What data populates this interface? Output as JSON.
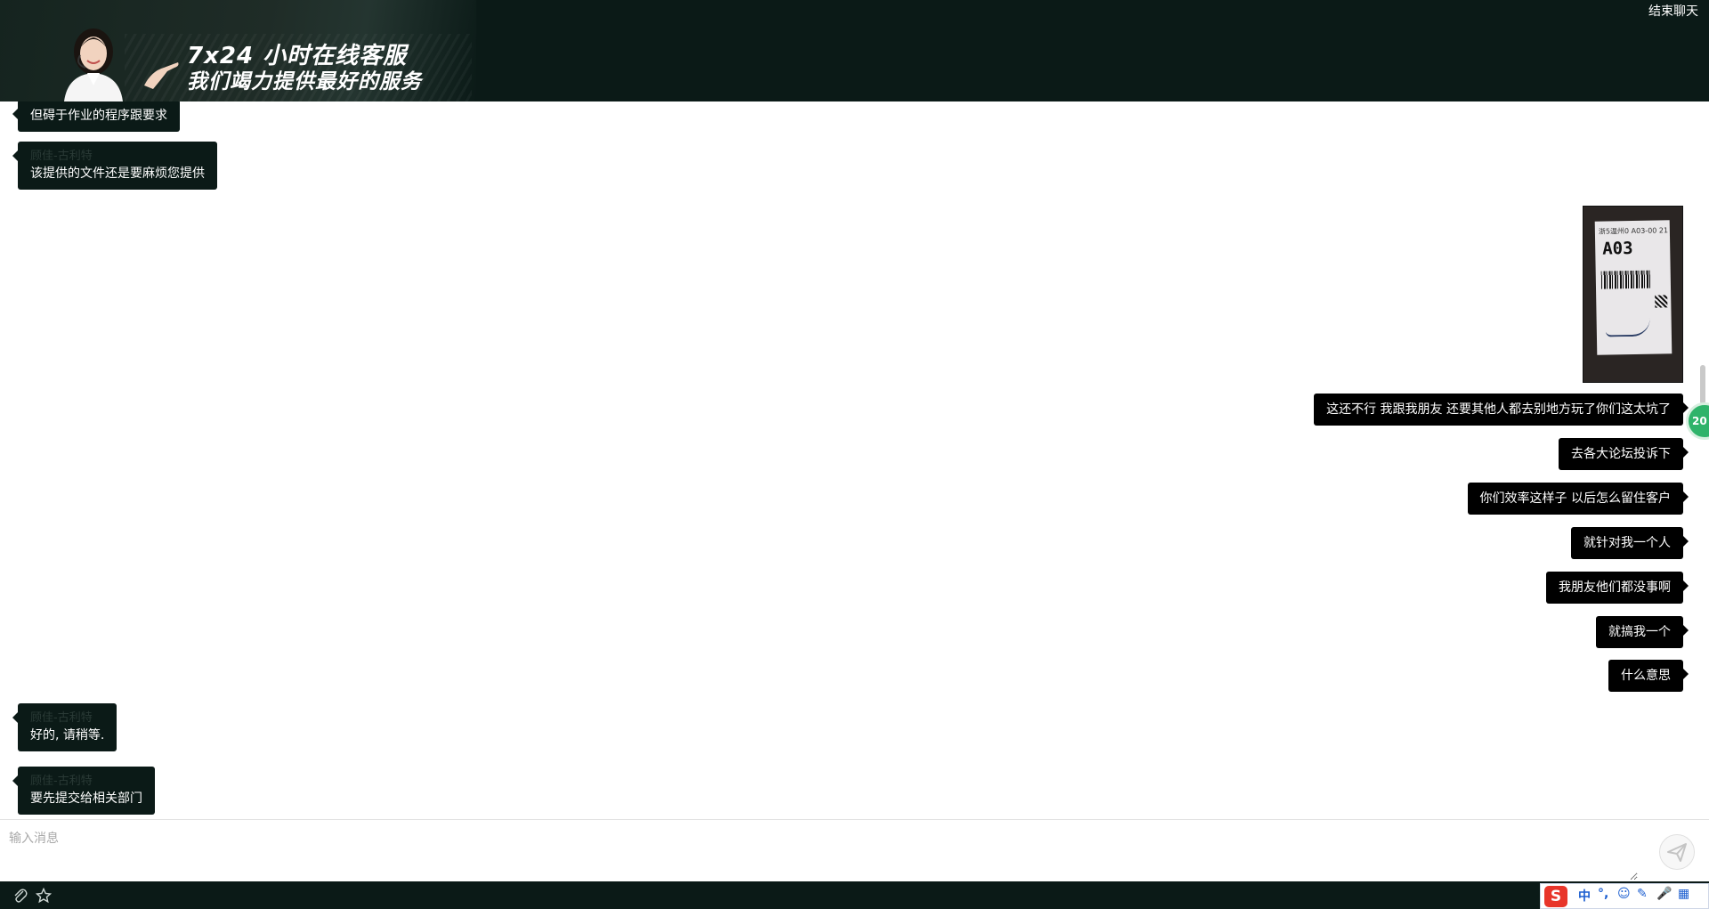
{
  "header": {
    "banner_line1": "7x24 小时在线客服",
    "banner_line2": "我们竭力提供最好的服务",
    "end_chat_label": "结束聊天",
    "background_color": "#0b1a17"
  },
  "chat": {
    "sender_name": "顾佳-古利特",
    "messages": [
      {
        "side": "left",
        "text": "但碍于作业的程序跟要求",
        "has_sender": false
      },
      {
        "side": "left",
        "text": "该提供的文件还是要麻烦您提供",
        "has_sender": true
      },
      {
        "side": "right",
        "type": "image",
        "label_small": "浙5温州0 A03-00 21",
        "label_code": "A03"
      },
      {
        "side": "right",
        "text": "这还不行 我跟我朋友 还要其他人都去别地方玩了你们这太坑了"
      },
      {
        "side": "right",
        "text": "去各大论坛投诉下"
      },
      {
        "side": "right",
        "text": "你们效率这样子 以后怎么留住客户"
      },
      {
        "side": "right",
        "text": "就针对我一个人"
      },
      {
        "side": "right",
        "text": "我朋友他们都没事啊"
      },
      {
        "side": "right",
        "text": "就搞我一个"
      },
      {
        "side": "right",
        "text": "什么意思"
      },
      {
        "side": "left",
        "text": "好的, 请稍等.",
        "has_sender": true
      },
      {
        "side": "left",
        "text": "要先提交给相关部门",
        "has_sender": true
      }
    ],
    "float_widget_text": "20"
  },
  "input": {
    "placeholder": "输入消息",
    "value": ""
  },
  "toolbar": {
    "icons": [
      "attachment-icon",
      "star-icon"
    ],
    "ime": {
      "logo": "S",
      "items": [
        "中",
        "°,",
        "☺",
        "✎",
        "🎤",
        "▦"
      ]
    }
  }
}
